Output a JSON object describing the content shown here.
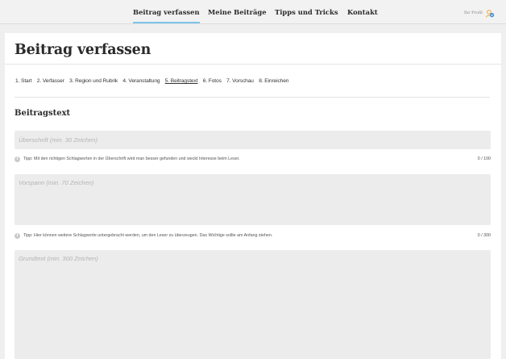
{
  "nav": {
    "items": [
      {
        "label": "Beitrag verfassen",
        "active": true
      },
      {
        "label": "Meine Beiträge",
        "active": false
      },
      {
        "label": "Tipps und Tricks",
        "active": false
      },
      {
        "label": "Kontakt",
        "active": false
      }
    ],
    "profile_label": "Ihr Profil",
    "profile_icon": "person-pin-icon",
    "accent": "#7ec3ea"
  },
  "page": {
    "title": "Beitrag verfassen",
    "steps": [
      "1. Start",
      "2. Verfasser",
      "3. Region und Rubrik",
      "4. Veranstaltung",
      "5. Beitragstext",
      "6. Fotos",
      "7. Vorschau",
      "8. Einreichen"
    ],
    "current_step_index": 4
  },
  "form": {
    "section_title": "Beitragstext",
    "headline": {
      "value": "",
      "placeholder": "Überschrift (min. 30 Zeichen)",
      "hint": "Tipp: Mit den richtigen Schlagworten in der Überschrift wird man besser gefunden und weckt Interesse beim Leser.",
      "counter": "0 / 100"
    },
    "lead": {
      "value": "",
      "placeholder": "Vorspann (min. 70 Zeichen)",
      "hint": "Tipp: Hier können weitere Schlagworte untergebracht werden, um den Leser zu überzeugen. Das Wichtige sollte am Anfang stehen.",
      "counter": "0 / 300"
    },
    "body": {
      "value": "",
      "placeholder": "Grundtext (min. 300 Zeichen)"
    }
  }
}
